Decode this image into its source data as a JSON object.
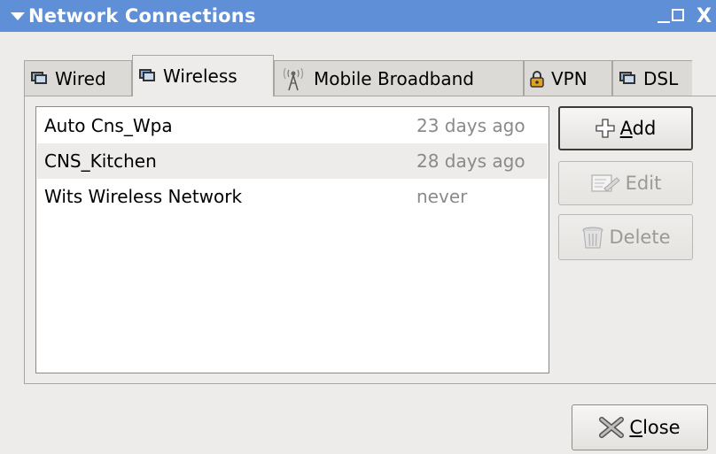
{
  "window": {
    "title": "Network Connections",
    "minimize_symbol": "_",
    "close_symbol": "X"
  },
  "tabs": [
    {
      "label": "Wired",
      "icon": "network-icon",
      "active": false
    },
    {
      "label": "Wireless",
      "icon": "network-icon",
      "active": true
    },
    {
      "label": "Mobile Broadband",
      "icon": "antenna-icon",
      "active": false
    },
    {
      "label": "VPN",
      "icon": "lock-icon",
      "active": false
    },
    {
      "label": "DSL",
      "icon": "network-icon",
      "active": false
    }
  ],
  "connections": [
    {
      "name": "Auto Cns_Wpa",
      "last_used": "23 days ago"
    },
    {
      "name": "CNS_Kitchen",
      "last_used": "28 days ago"
    },
    {
      "name": "Wits Wireless Network",
      "last_used": "never"
    }
  ],
  "buttons": {
    "add": {
      "label_underlined": "A",
      "label_rest": "dd",
      "icon": "plus-icon"
    },
    "edit": {
      "label": "Edit",
      "icon": "edit-icon"
    },
    "delete": {
      "label": "Delete",
      "icon": "trash-icon"
    },
    "close": {
      "label_underlined": "C",
      "label_rest": "lose",
      "icon": "close-icon"
    }
  },
  "colors": {
    "titlebar": "#5f8fd6",
    "window_bg": "#edecea",
    "muted_text": "#8a8a8a"
  }
}
